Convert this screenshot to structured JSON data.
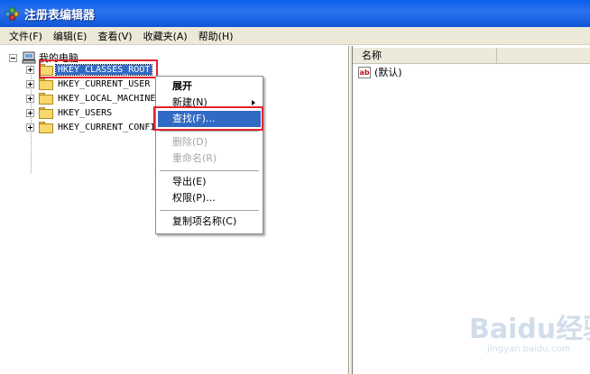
{
  "window": {
    "title": "注册表编辑器",
    "accent": "#0a5ee8"
  },
  "menubar": {
    "items": [
      "文件(F)",
      "编辑(E)",
      "查看(V)",
      "收藏夹(A)",
      "帮助(H)"
    ]
  },
  "tree": {
    "root_label": "我的电脑",
    "keys": [
      "HKEY_CLASSES_ROOT",
      "HKEY_CURRENT_USER",
      "HKEY_LOCAL_MACHINE",
      "HKEY_USERS",
      "HKEY_CURRENT_CONFIG"
    ],
    "selected_key": "HKEY_CLASSES_ROOT"
  },
  "values_pane": {
    "column_name": "名称",
    "rows": [
      {
        "name": "(默认)",
        "icon": "string-value-icon"
      }
    ]
  },
  "context_menu": {
    "expand": "展开",
    "new": "新建(N)",
    "find": "查找(F)...",
    "delete": "删除(D)",
    "rename": "重命名(R)",
    "export": "导出(E)",
    "permissions": "权限(P)...",
    "copy_key_name": "复制项名称(C)",
    "highlighted": "find"
  },
  "annotations": {
    "highlight_color": "#e0242c"
  },
  "watermark": {
    "brand": "Baidu经验",
    "url": "jingyan.baidu.com"
  }
}
